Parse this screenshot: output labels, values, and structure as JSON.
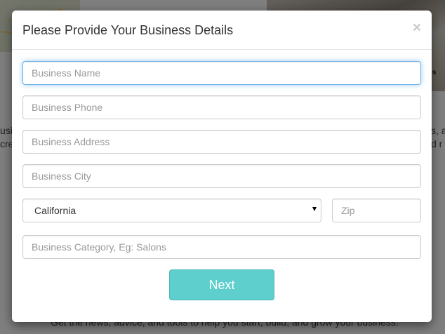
{
  "background": {
    "caption": "ices",
    "text_lines": [
      "usi",
      "cre",
      "s, a",
      "d r",
      "Get the news, advice, and tools to help you start, build, and grow your business."
    ]
  },
  "modal": {
    "title": "Please Provide Your Business Details",
    "close_label": "×",
    "fields": {
      "business_name_placeholder": "Business Name",
      "business_phone_placeholder": "Business Phone",
      "business_address_placeholder": "Business Address",
      "business_city_placeholder": "Business City",
      "state_selected": "California",
      "zip_placeholder": "Zip",
      "business_category_placeholder": "Business Category, Eg: Salons"
    },
    "next_label": "Next"
  },
  "colors": {
    "accent": "#5ecfcd",
    "focus": "#66afe9"
  }
}
